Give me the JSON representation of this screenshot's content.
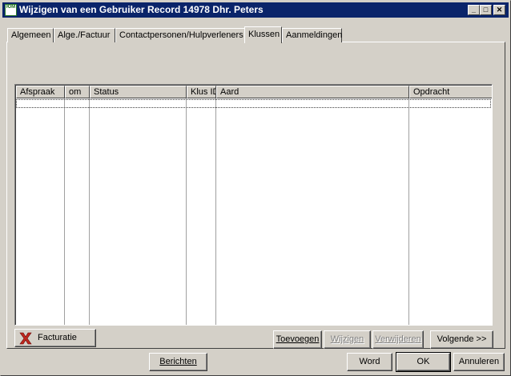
{
  "window": {
    "title": "Wijzigen van een Gebruiker Record 14978 Dhr. Peters",
    "icon_text": "ЮМ",
    "controls": {
      "minimize": "_",
      "maximize": "□",
      "close": "✕"
    }
  },
  "tabs": [
    {
      "label": "Algemeen",
      "active": false
    },
    {
      "label": "Alge./Factuur",
      "active": false
    },
    {
      "label": "Contactpersonen/Hulpverleners",
      "active": false
    },
    {
      "label": "Klussen",
      "active": true
    },
    {
      "label": "Aanmeldingen",
      "active": false
    }
  ],
  "grid": {
    "columns": [
      "Afspraak",
      "om",
      "Status",
      "Klus ID",
      "Aard",
      "Opdracht"
    ],
    "rows": []
  },
  "buttons": {
    "facturatie": "Facturatie",
    "toevoegen": "Toevoegen",
    "wijzigen": "Wijzigen",
    "verwijderen": "Verwijderen",
    "volgende": "Volgende >>",
    "berichten": "Berichten",
    "word": "Word",
    "ok": "OK",
    "annuleren": "Annuleren"
  },
  "colors": {
    "titlebar": "#0a246a",
    "face": "#d4d0c8",
    "facturatie_icon": "#c0281e"
  }
}
